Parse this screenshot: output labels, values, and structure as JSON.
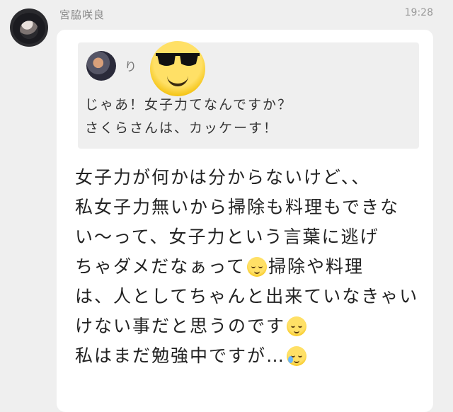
{
  "sender": {
    "name": "宮脇咲良",
    "timestamp": "19:28"
  },
  "quote": {
    "name": "り",
    "lines": [
      "じゃあ！女子力てなんですか？",
      "さくらさんは、カッケーす！"
    ]
  },
  "message": {
    "lines": [
      "女子力が何かは分からないけど、、",
      "私女子力無いから掃除も料理もできな",
      "い〜って、女子力という言葉に逃げ",
      "ちゃダメだなぁって",
      "掃除や料理",
      "は、人としてちゃんと出来ていなきゃい",
      "けない事だと思うのです",
      "私はまだ勉強中ですが…"
    ]
  },
  "emojis": {
    "cover": "sunglasses-emoji",
    "inline": [
      "relieved-emoji",
      "relieved-emoji",
      "sweat-emoji"
    ]
  },
  "colors": {
    "background": "#efefef",
    "bubble": "#ffffff",
    "quote_bg": "#efefef",
    "emoji_yellow": "#f5c518"
  }
}
